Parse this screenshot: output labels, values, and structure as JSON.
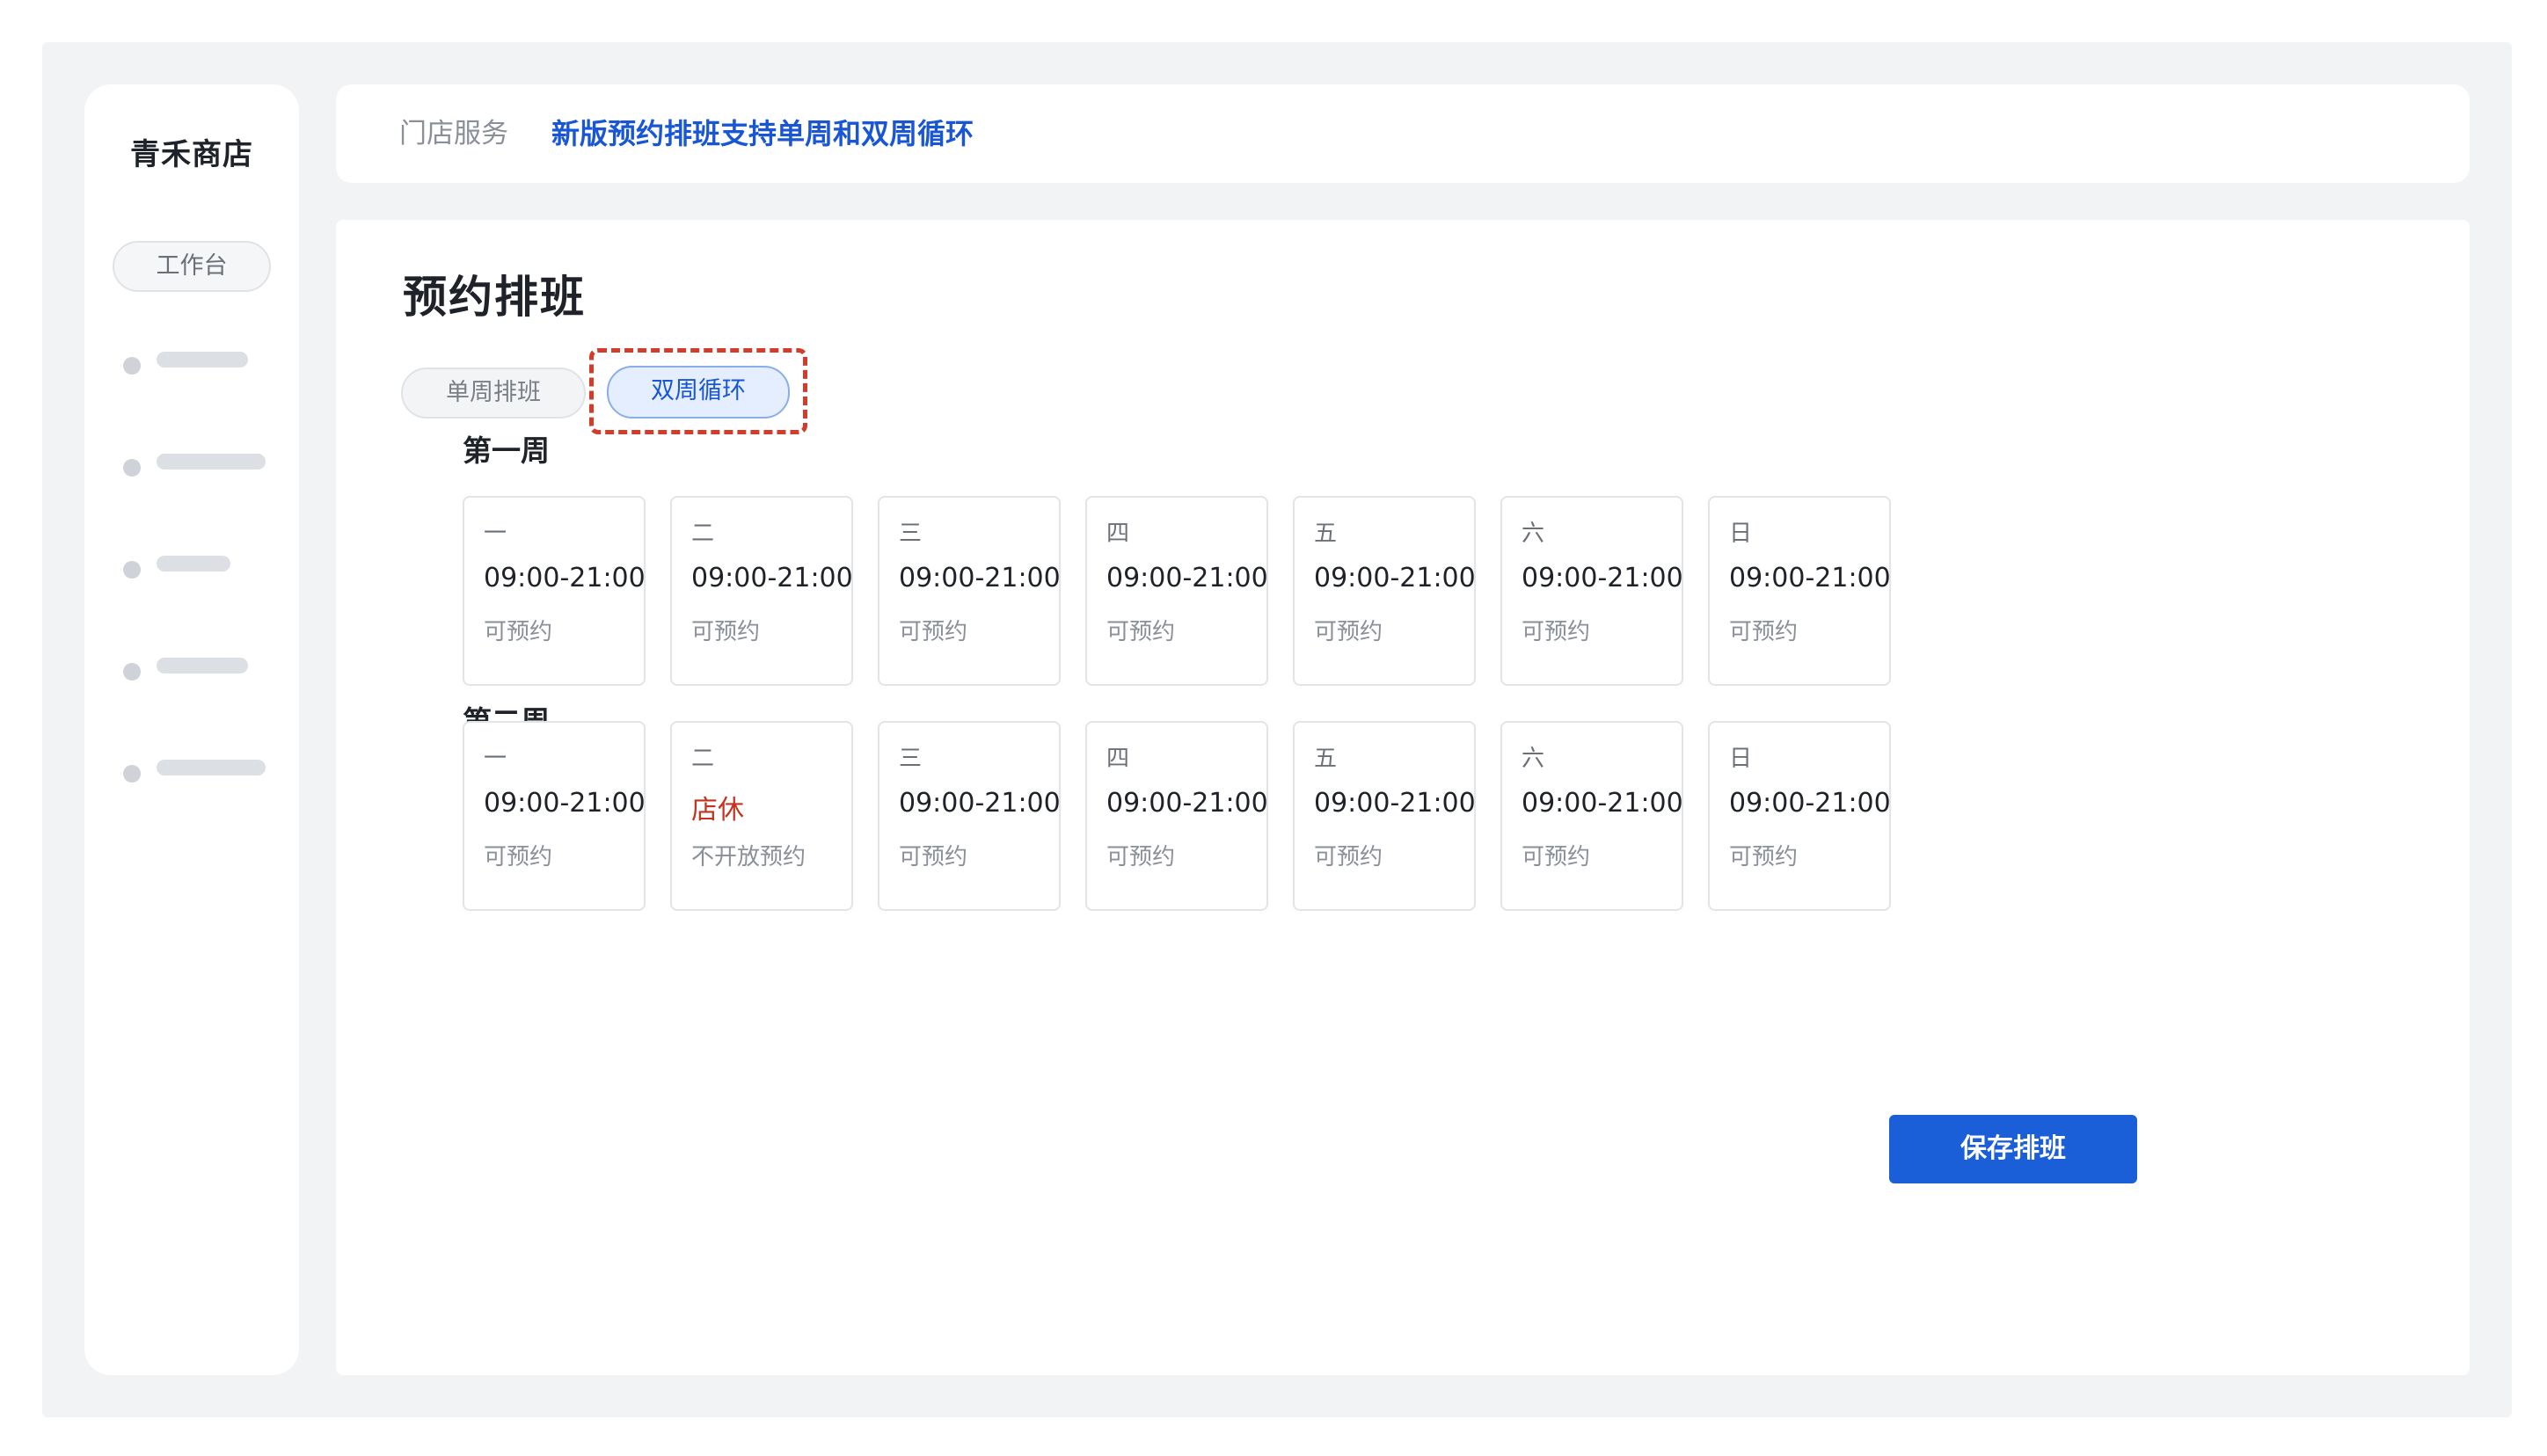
{
  "sidebar": {
    "brand": "青禾商店",
    "active_item": "工作台"
  },
  "header": {
    "breadcrumb": "门店服务",
    "announcement": "新版预约排班支持单周和双周循环"
  },
  "main": {
    "title": "预约排班",
    "tabs": [
      {
        "label": "单周排班",
        "active": false
      },
      {
        "label": "双周循环",
        "active": true
      }
    ],
    "weeks": [
      {
        "label": "第一周",
        "days": [
          {
            "day": "一",
            "time": "09:00-21:00",
            "status": "可预约"
          },
          {
            "day": "二",
            "time": "09:00-21:00",
            "status": "可预约"
          },
          {
            "day": "三",
            "time": "09:00-21:00",
            "status": "可预约"
          },
          {
            "day": "四",
            "time": "09:00-21:00",
            "status": "可预约"
          },
          {
            "day": "五",
            "time": "09:00-21:00",
            "status": "可预约"
          },
          {
            "day": "六",
            "time": "09:00-21:00",
            "status": "可预约"
          },
          {
            "day": "日",
            "time": "09:00-21:00",
            "status": "可预约"
          }
        ]
      },
      {
        "label": "第二周",
        "days": [
          {
            "day": "一",
            "time": "09:00-21:00",
            "status": "可预约"
          },
          {
            "day": "二",
            "time": "店休",
            "status": "不开放预约"
          },
          {
            "day": "三",
            "time": "09:00-21:00",
            "status": "可预约"
          },
          {
            "day": "四",
            "time": "09:00-21:00",
            "status": "可预约"
          },
          {
            "day": "五",
            "time": "09:00-21:00",
            "status": "可预约"
          },
          {
            "day": "六",
            "time": "09:00-21:00",
            "status": "可预约"
          },
          {
            "day": "日",
            "time": "09:00-21:00",
            "status": "可预约"
          }
        ]
      }
    ],
    "save_label": "保存排班"
  },
  "colors": {
    "accent": "#1956d4",
    "closed": "#c7321f",
    "highlight": "#d23c2a"
  }
}
